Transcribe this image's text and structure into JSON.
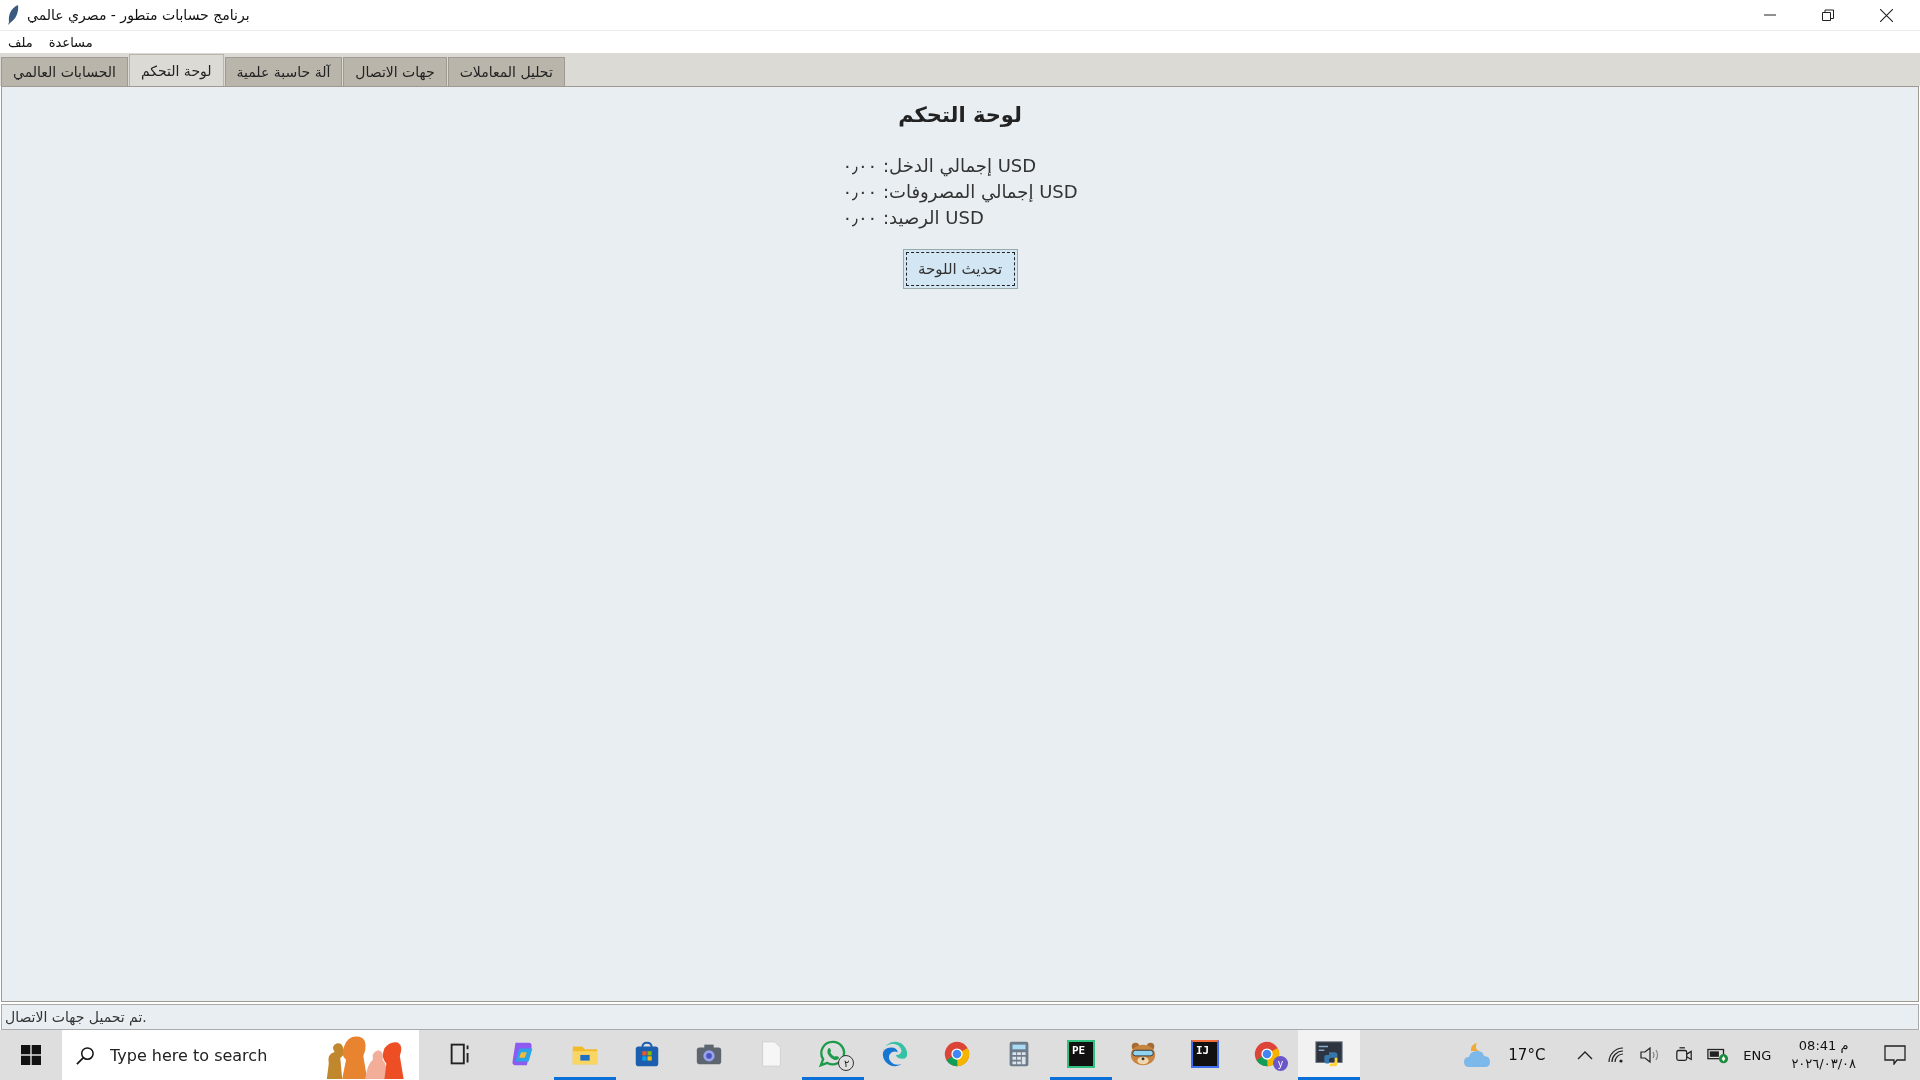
{
  "window": {
    "title": "برنامج حسابات متطور - مصري عالمي"
  },
  "menu": [
    "مساعدة",
    "ملف"
  ],
  "tabs": [
    {
      "label": "تحليل المعاملات",
      "selected": false
    },
    {
      "label": "جهات الاتصال",
      "selected": false
    },
    {
      "label": "آلة حاسبة علمية",
      "selected": false
    },
    {
      "label": "لوحة التحكم",
      "selected": true
    },
    {
      "label": "الحسابات العالمي",
      "selected": false
    }
  ],
  "dashboard": {
    "title": "لوحة التحكم",
    "lines": [
      "USD إجمالي الدخل: ٠٫٠٠",
      "USD إجمالي المصروفات: ٠٫٠٠",
      "USD الرصيد: ٠٫٠٠"
    ],
    "button": {
      "label": "تحديث اللوحة",
      "focused": true
    }
  },
  "status_bar": "تم تحميل جهات الاتصال.",
  "taskbar": {
    "search": {
      "placeholder": "Type here to search"
    },
    "apps": [
      {
        "kind": "taskview",
        "running": false
      },
      {
        "kind": "copilot",
        "running": false
      },
      {
        "kind": "explorer",
        "running": true
      },
      {
        "kind": "store",
        "running": false
      },
      {
        "kind": "camera",
        "running": false
      },
      {
        "kind": "file",
        "running": false
      },
      {
        "kind": "whatsapp",
        "running": true,
        "badge": "٢"
      },
      {
        "kind": "edge",
        "running": false
      },
      {
        "kind": "chrome",
        "running": false
      },
      {
        "kind": "calculator",
        "running": false
      },
      {
        "kind": "pe",
        "running": true,
        "label": "PE"
      },
      {
        "kind": "bear",
        "running": false
      },
      {
        "kind": "ij",
        "running": false,
        "monogram": "IJ"
      },
      {
        "kind": "chrome",
        "running": false,
        "profile": "y"
      },
      {
        "kind": "python",
        "running": true,
        "active": true
      }
    ],
    "weather": "17°C",
    "language": "ENG",
    "time": "08:41 م",
    "date": "٢٠٢٦/٠٣/٠٨"
  }
}
